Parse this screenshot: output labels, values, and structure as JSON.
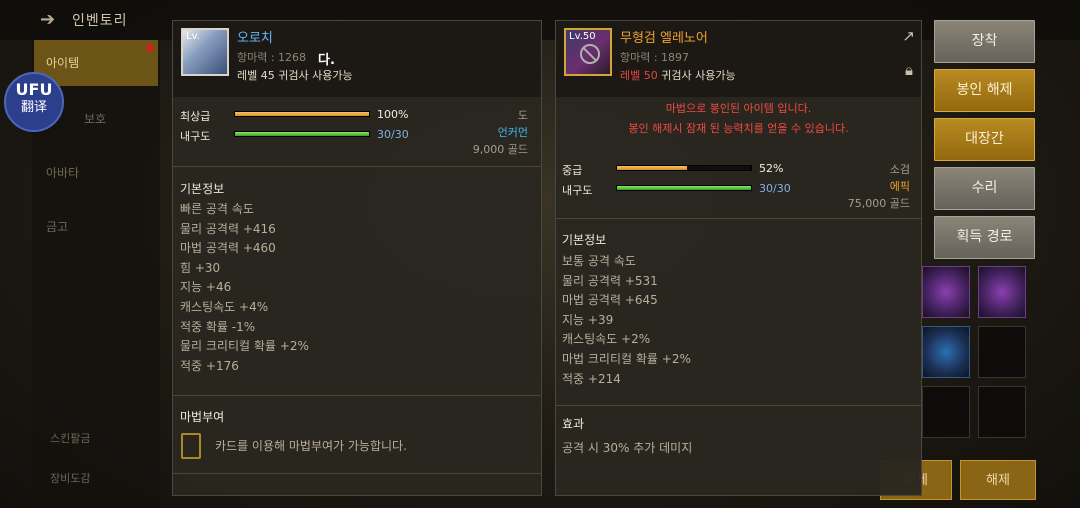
{
  "background": {
    "title": "인벤토리",
    "tabs": [
      "아이템",
      "보호",
      "아바타",
      "금고"
    ],
    "bottom_links": [
      "스킨팔금",
      "장비도감"
    ],
    "bottom_buttons": [
      "해제",
      "해제"
    ]
  },
  "translate_badge": {
    "logo": "UFU",
    "label": "翻译"
  },
  "left_item": {
    "level_badge": "Lv.",
    "name": "오로치",
    "defense": "항마력 : 1268",
    "overlay_text": "다.",
    "requirement": "레벨 45 귀검사 사용가능",
    "grade_label": "최상급",
    "grade_value": "100%",
    "grade_percent": 100,
    "durability_label": "내구도",
    "durability_value": "30/30",
    "durability_percent": 100,
    "type": "도",
    "rarity": "언커먼",
    "price": "9,000 골드",
    "basic_info_title": "기본정보",
    "stats": [
      "빠른 공격 속도",
      "물리 공격력 +416",
      "마법 공격력 +460",
      "힘 +30",
      "지능 +46",
      "캐스팅속도 +4%",
      "적중 확률 -1%",
      "물리 크리티컬 확률 +2%",
      "적중 +176"
    ],
    "enchant_title": "마법부여",
    "enchant_text": "카드를 이용해 마법부여가 가능합니다."
  },
  "right_item": {
    "level_badge": "Lv.50",
    "name": "무형검 엘레노어",
    "defense": "항마력 : 1897",
    "requirement_red": "레벨 50",
    "requirement_rest": " 귀검사 사용가능",
    "seal_warning_1": "마법으로 봉인된 아이템 입니다.",
    "seal_warning_2": "봉인 해제시 잠재 된 능력치를 얻을 수 있습니다.",
    "grade_label": "중급",
    "grade_value": "52%",
    "grade_percent": 52,
    "durability_label": "내구도",
    "durability_value": "30/30",
    "durability_percent": 100,
    "type": "소검",
    "rarity": "에픽",
    "price": "75,000 골드",
    "basic_info_title": "기본정보",
    "stats": [
      "보통 공격 속도",
      "물리 공격력 +531",
      "마법 공격력 +645",
      "지능 +39",
      "캐스팅속도 +2%",
      "마법 크리티컬 확률 +2%",
      "적중 +214"
    ],
    "effect_title": "효과",
    "effect_text": "공격 시 30% 추가 데미지"
  },
  "actions": {
    "equip": "장착",
    "unseal": "봉인 해제",
    "forge": "대장간",
    "repair": "수리",
    "acquire_route": "획득 경로"
  }
}
